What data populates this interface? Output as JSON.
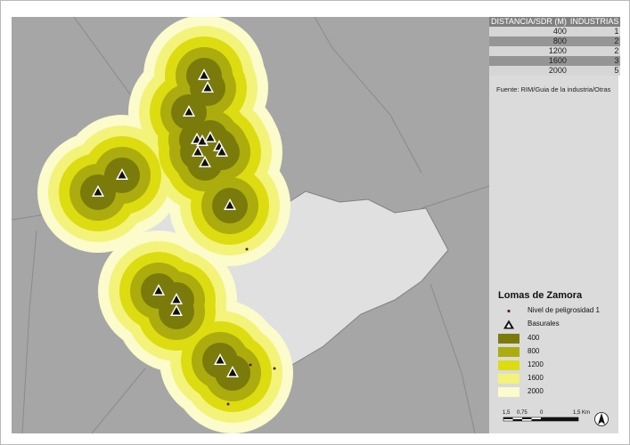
{
  "colors": {
    "background": "#a6a6a6",
    "municipality_fill": "#e0e0e0",
    "boundary": "#808080",
    "buffer_400": "#7b7b0c",
    "buffer_800": "#acac0e",
    "buffer_1200": "#dcdc10",
    "buffer_1600": "#f3f37a",
    "buffer_2000": "#fbfbcb",
    "hazard_point": "#5a1e40"
  },
  "table": {
    "header_distance": "DISTANCIA/SDR (M)",
    "header_industries": "INDUSTRIAS",
    "rows": [
      {
        "distance": "400",
        "count": "1"
      },
      {
        "distance": "800",
        "count": "2"
      },
      {
        "distance": "1200",
        "count": "2"
      },
      {
        "distance": "1600",
        "count": "3"
      },
      {
        "distance": "2000",
        "count": "5"
      }
    ]
  },
  "source": "Fuente: RIM/Guia de la industria/Otras",
  "legend": {
    "title": "Lomas de Zamora",
    "hazard_label": "Nivel de peligrosidad 1",
    "landfill_label": "Basurales",
    "buffer_labels": [
      "400",
      "800",
      "1200",
      "1600",
      "2000"
    ]
  },
  "scale": {
    "labels": [
      "1,5",
      "0,75",
      "0",
      "1,5 Km"
    ]
  }
}
